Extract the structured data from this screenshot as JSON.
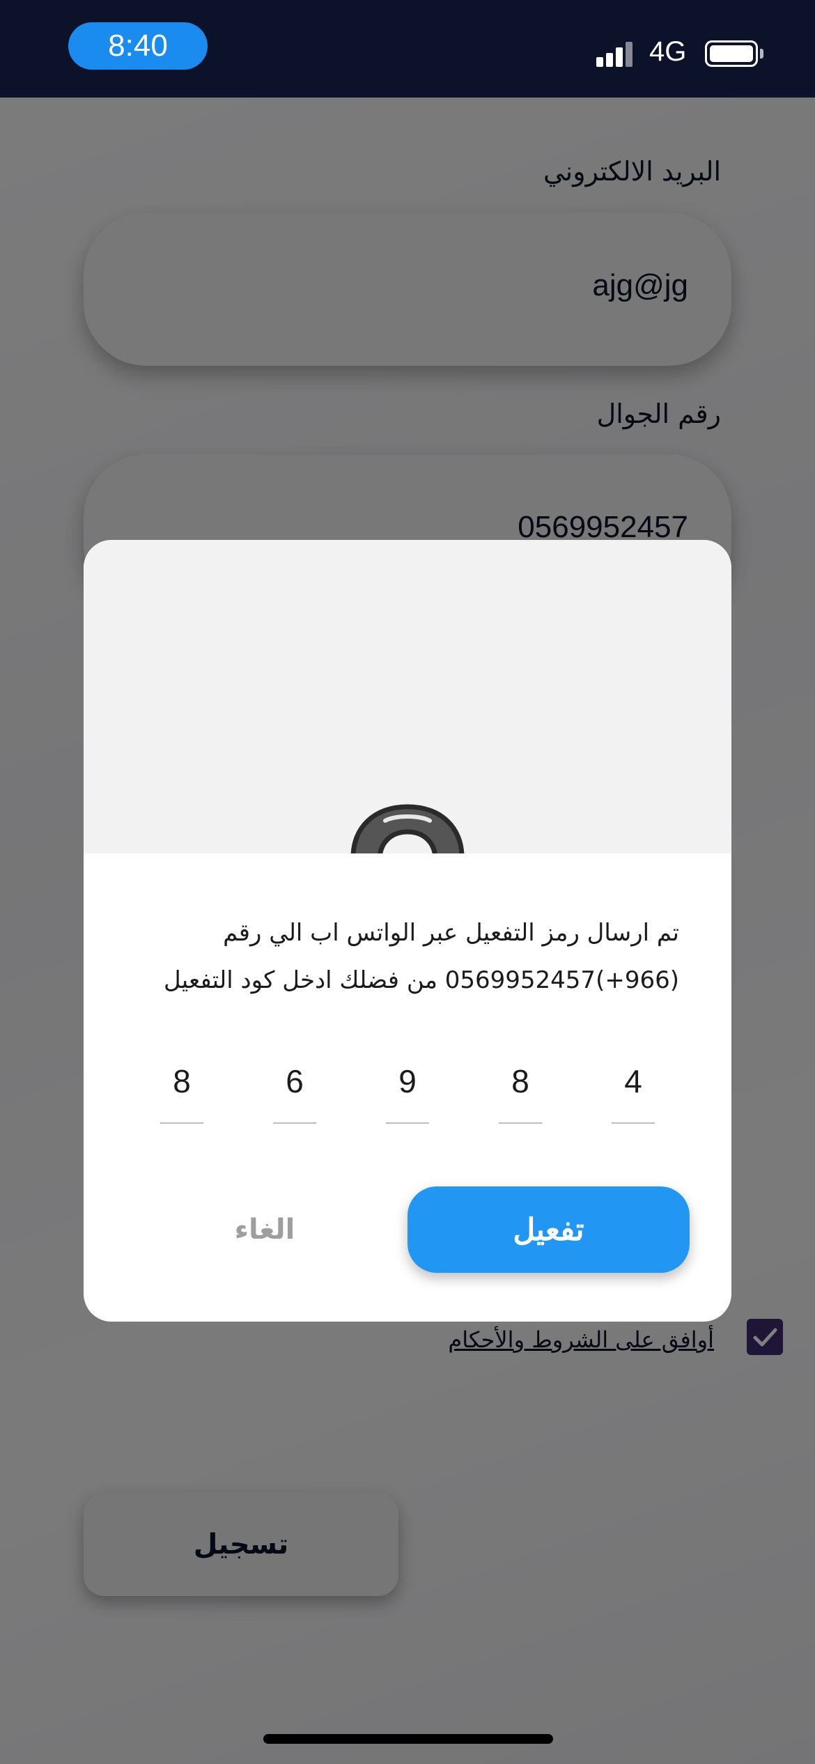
{
  "status_bar": {
    "time": "8:40",
    "network": "4G"
  },
  "form": {
    "email_label": "البريد الالكتروني",
    "email_value": "ajg@jg",
    "phone_label": "رقم الجوال",
    "phone_value": "0569952457",
    "terms_label": "أوافق على الشروط والأحكام",
    "terms_checked": true,
    "register_label": "تسجيل"
  },
  "dialog": {
    "message": "تم ارسال رمز التفعيل عبر الواتس اب الي رقم (966+)0569952457 من فضلك ادخل كود التفعيل",
    "otp_digits": [
      "8",
      "6",
      "9",
      "8",
      "4"
    ],
    "activate_label": "تفعيل",
    "cancel_label": "الغاء"
  },
  "colors": {
    "status_bar_bg": "#0b1229",
    "time_pill": "#1a8cf0",
    "primary_button": "#2196f3",
    "checkbox": "#3d2a6e",
    "text_dark": "#0b1229"
  },
  "icons": [
    "signal-icon",
    "battery-icon",
    "lock-icon",
    "checkmark-icon"
  ]
}
